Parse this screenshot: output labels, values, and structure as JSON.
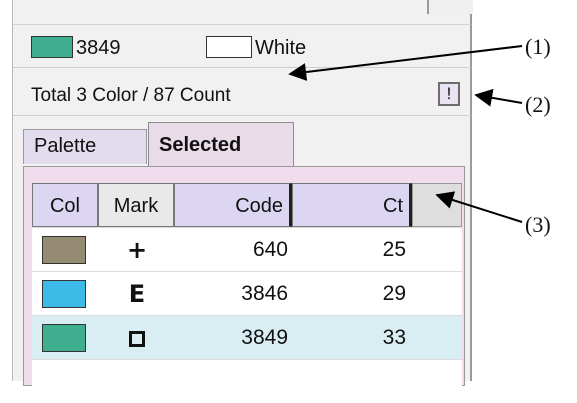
{
  "summary": {
    "main_color_code": "3849",
    "background_label": "White",
    "total_text": "Total 3 Color / 87 Count",
    "warning_button": "!"
  },
  "tabs": [
    {
      "label": "Palette"
    },
    {
      "label": "Selected"
    }
  ],
  "table": {
    "headers": [
      "Col",
      "Mark",
      "Code",
      "Ct"
    ],
    "rows": [
      {
        "color": "#958a72",
        "mark": "+",
        "code": "640",
        "count": "25"
      },
      {
        "color": "#3dbbe8",
        "mark": "E",
        "code": "3846",
        "count": "29"
      },
      {
        "color": "#3fae8f",
        "mark": "square",
        "code": "3849",
        "count": "33"
      }
    ]
  },
  "callouts": [
    "(1)",
    "(2)",
    "(3)"
  ],
  "colors": {
    "main_swatch": "#3fae8f",
    "background_swatch": "#ffffff",
    "selected_row": "#d9eef3",
    "tab_selected": "#eadbe9",
    "header_bg": "#dcd6f2"
  }
}
